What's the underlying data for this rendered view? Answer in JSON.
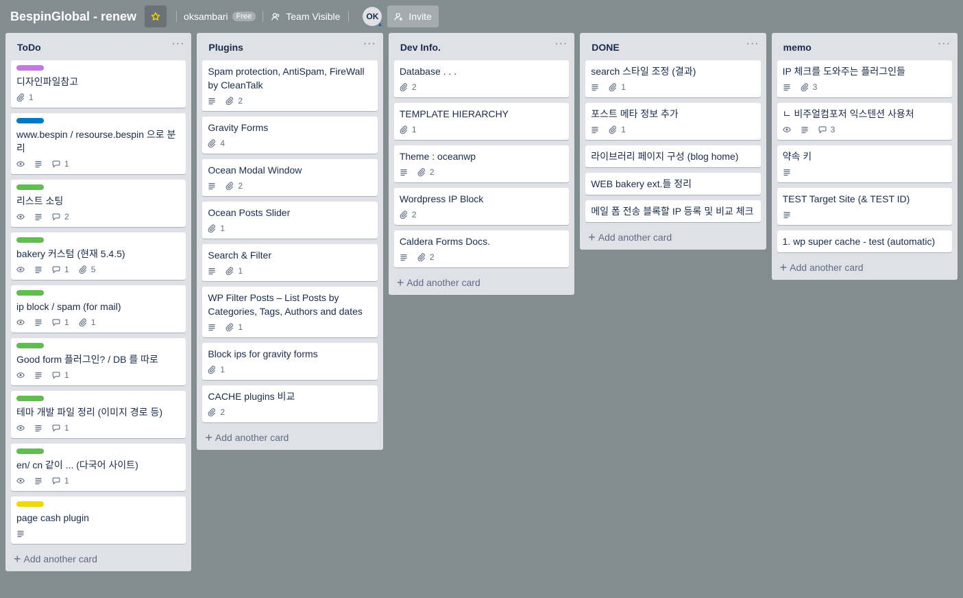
{
  "header": {
    "board_title": "BespinGlobal - renew",
    "username": "oksambari",
    "plan_badge": "Free",
    "visibility": "Team Visible",
    "avatar_initials": "OK",
    "invite_label": "Invite"
  },
  "colors": {
    "purple": "#c377e0",
    "blue": "#0079bf",
    "green": "#61bd4f",
    "yellow": "#f2d600",
    "star": "#f2d600"
  },
  "add_card_label": "Add another card",
  "lists": [
    {
      "title": "ToDo",
      "cards": [
        {
          "label": "purple",
          "title": "디자인파일참고",
          "attach": "1"
        },
        {
          "label": "blue",
          "title": "www.bespin / resourse.bespin 으로 분리",
          "watch": true,
          "desc": true,
          "comments": "1"
        },
        {
          "label": "green",
          "title": "리스트 소팅",
          "watch": true,
          "desc": true,
          "comments": "2"
        },
        {
          "label": "green",
          "title": "bakery 커스텀 (현재 5.4.5)",
          "watch": true,
          "desc": true,
          "comments": "1",
          "attach": "5"
        },
        {
          "label": "green",
          "title": "ip block / spam (for mail)",
          "watch": true,
          "desc": true,
          "comments": "1",
          "attach": "1"
        },
        {
          "label": "green",
          "title": "Good form 플러그인? / DB 를 따로",
          "watch": true,
          "desc": true,
          "comments": "1"
        },
        {
          "label": "green",
          "title": "테마 개발 파일 정리 (이미지 경로 등)",
          "watch": true,
          "desc": true,
          "comments": "1"
        },
        {
          "label": "green",
          "title": "en/ cn 같이 ... (다국어 사이트)",
          "watch": true,
          "desc": true,
          "comments": "1"
        },
        {
          "label": "yellow",
          "title": "page cash plugin",
          "desc": true
        }
      ]
    },
    {
      "title": "Plugins",
      "cards": [
        {
          "title": "Spam protection, AntiSpam, FireWall by CleanTalk",
          "desc": true,
          "attach": "2"
        },
        {
          "title": "Gravity Forms",
          "attach": "4"
        },
        {
          "title": "Ocean Modal Window",
          "desc": true,
          "attach": "2"
        },
        {
          "title": "Ocean Posts Slider",
          "attach": "1"
        },
        {
          "title": "Search & Filter",
          "desc": true,
          "attach": "1"
        },
        {
          "title": "WP Filter Posts – List Posts by Categories, Tags, Authors and dates",
          "desc": true,
          "attach": "1"
        },
        {
          "title": "Block ips for gravity forms",
          "attach": "1"
        },
        {
          "title": "CACHE plugins 비교",
          "attach": "2"
        }
      ]
    },
    {
      "title": "Dev Info.",
      "cards": [
        {
          "title": "Database . . .",
          "attach": "2"
        },
        {
          "title": "TEMPLATE HIERARCHY",
          "attach": "1"
        },
        {
          "title": "Theme : oceanwp",
          "desc": true,
          "attach": "2"
        },
        {
          "title": "Wordpress IP Block",
          "attach": "2"
        },
        {
          "title": "Caldera Forms Docs.",
          "desc": true,
          "attach": "2"
        }
      ]
    },
    {
      "title": "DONE",
      "cards": [
        {
          "title": "search 스타일 조정 (결과)",
          "desc": true,
          "attach": "1"
        },
        {
          "title": "포스트 메타 정보 추가",
          "desc": true,
          "attach": "1"
        },
        {
          "title": "라이브러리 페이지 구성 (blog home)"
        },
        {
          "title": "WEB bakery ext.들 정리"
        },
        {
          "title": "메일 폼 전송 블록할 IP 등록 및 비교 체크"
        }
      ]
    },
    {
      "title": "memo",
      "cards": [
        {
          "title": "IP 체크를 도와주는 플러그인들",
          "desc": true,
          "attach": "3"
        },
        {
          "title": "ㄴ 비주얼컴포저 익스텐션 사용처",
          "watch": true,
          "desc": true,
          "comments": "3"
        },
        {
          "title": "약속 키",
          "desc": true
        },
        {
          "title": "TEST Target Site (& TEST ID)",
          "desc": true
        },
        {
          "title": "1. wp super cache - test (automatic)"
        }
      ]
    }
  ]
}
